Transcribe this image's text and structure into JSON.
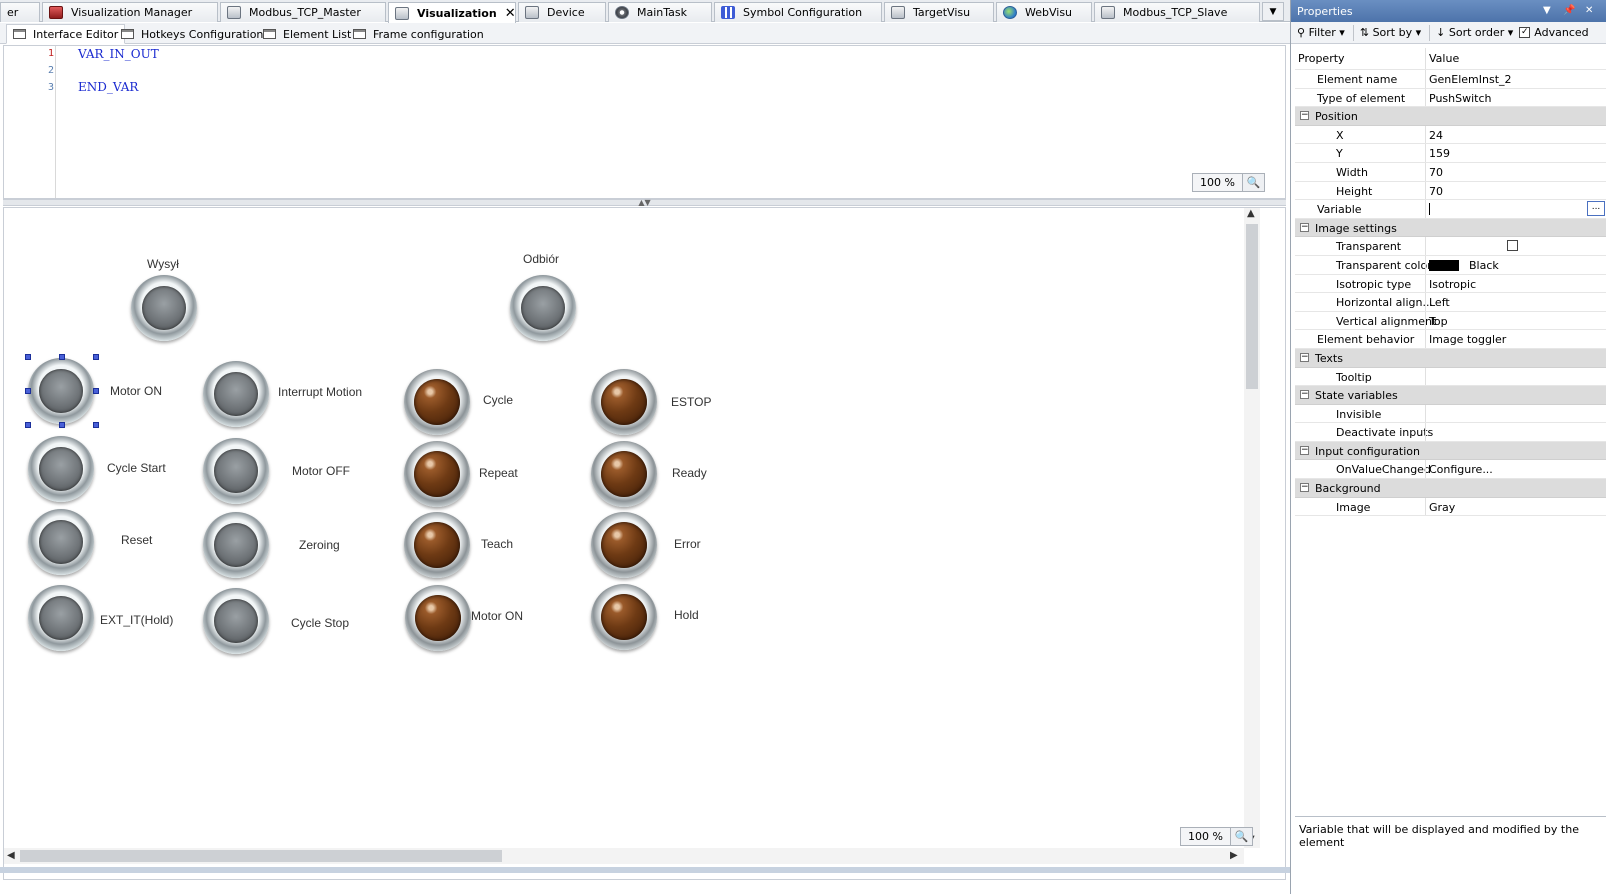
{
  "doc_tabs": [
    {
      "label": "er",
      "icon": "none"
    },
    {
      "label": "Visualization Manager",
      "icon": "red"
    },
    {
      "label": "Modbus_TCP_Master",
      "icon": "device"
    },
    {
      "label": "Visualization",
      "icon": "visu",
      "active": true
    },
    {
      "label": "Device",
      "icon": "device"
    },
    {
      "label": "MainTask",
      "icon": "gear"
    },
    {
      "label": "Symbol Configuration",
      "icon": "sym"
    },
    {
      "label": "TargetVisu",
      "icon": "device"
    },
    {
      "label": "WebVisu",
      "icon": "globe"
    },
    {
      "label": "Modbus_TCP_Slave",
      "icon": "device"
    }
  ],
  "sub_tabs": [
    "Interface Editor",
    "Hotkeys Configuration",
    "Element List",
    "Frame configuration"
  ],
  "declaration": {
    "line_numbers": [
      "1",
      "2",
      "3"
    ],
    "lines": [
      "VAR_IN_OUT",
      "",
      "END_VAR"
    ],
    "zoom": "100 %"
  },
  "canvas": {
    "zoom": "100 %",
    "labels": {
      "wysyl": "Wysył",
      "odbior": "Odbiór",
      "motor_on_1": "Motor ON",
      "cycle_start": "Cycle Start",
      "reset": "Reset",
      "ext_it_hold": "EXT_IT(Hold)",
      "interrupt_motion": "Interrupt Motion",
      "motor_off": "Motor OFF",
      "zeroing": "Zeroing",
      "cycle_stop": "Cycle Stop",
      "cycle": "Cycle",
      "repeat": "Repeat",
      "teach": "Teach",
      "motor_on_2": "Motor ON",
      "estop": "ESTOP",
      "ready": "Ready",
      "error": "Error",
      "hold": "Hold"
    }
  },
  "properties": {
    "title": "Properties",
    "toolbar": {
      "filter": "Filter",
      "sort_by": "Sort by",
      "sort_order": "Sort order",
      "advanced": "Advanced"
    },
    "header": {
      "property": "Property",
      "value": "Value"
    },
    "rows": {
      "element_name": {
        "name": "Element name",
        "value": "GenElemInst_2"
      },
      "type_of_element": {
        "name": "Type of element",
        "value": "PushSwitch"
      },
      "position": {
        "name": "Position"
      },
      "x": {
        "name": "X",
        "value": "24"
      },
      "y": {
        "name": "Y",
        "value": "159"
      },
      "width": {
        "name": "Width",
        "value": "70"
      },
      "height": {
        "name": "Height",
        "value": "70"
      },
      "variable": {
        "name": "Variable",
        "value": "",
        "button": "..."
      },
      "image_settings": {
        "name": "Image settings"
      },
      "transparent": {
        "name": "Transparent"
      },
      "transparent_color": {
        "name": "Transparent color",
        "value": "Black"
      },
      "isotropic_type": {
        "name": "Isotropic type",
        "value": "Isotropic"
      },
      "horizontal_align": {
        "name": "Horizontal align...",
        "value": "Left"
      },
      "vertical_alignment": {
        "name": "Vertical alignment",
        "value": "Top"
      },
      "element_behavior": {
        "name": "Element behavior",
        "value": "Image toggler"
      },
      "texts": {
        "name": "Texts"
      },
      "tooltip": {
        "name": "Tooltip",
        "value": ""
      },
      "state_variables": {
        "name": "State variables"
      },
      "invisible": {
        "name": "Invisible",
        "value": ""
      },
      "deactivate_inputs": {
        "name": "Deactivate inputs",
        "value": ""
      },
      "input_configuration": {
        "name": "Input configuration"
      },
      "on_value_changed": {
        "name": "OnValueChanged",
        "value": "Configure..."
      },
      "background": {
        "name": "Background"
      },
      "image": {
        "name": "Image",
        "value": "Gray"
      }
    },
    "description": "Variable that will be displayed and modified by the element"
  },
  "colors": {
    "title_bar": "#5a80b8",
    "group_row": "#dcdcdc",
    "code": "#1a2ad0",
    "selection_handle": "#4960d8"
  }
}
